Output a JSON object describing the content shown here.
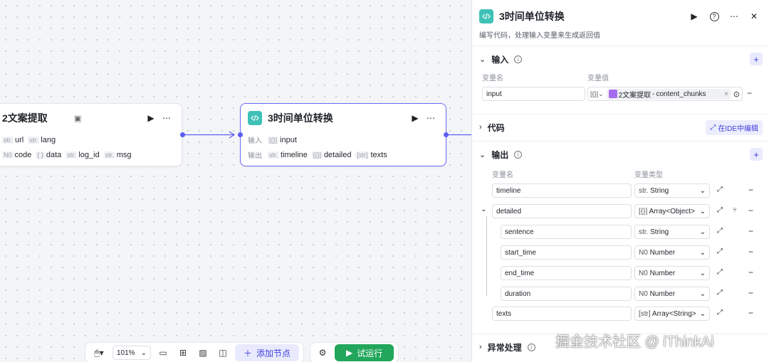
{
  "canvas": {
    "node2": {
      "title": "2文案提取",
      "inputs": [
        {
          "type": "str.",
          "name": "url"
        },
        {
          "type": "str.",
          "name": "lang"
        }
      ],
      "outputs": [
        {
          "type": "N0",
          "name": "code"
        },
        {
          "type": "{ }",
          "name": "data"
        },
        {
          "type": "str.",
          "name": "log_id"
        },
        {
          "type": "str.",
          "name": "msg"
        }
      ]
    },
    "node3": {
      "title": "3时间单位转换",
      "input_label": "输入",
      "output_label": "输出",
      "inputs": [
        {
          "type": "[{}]",
          "name": "input"
        }
      ],
      "outputs": [
        {
          "type": "str.",
          "name": "timeline"
        },
        {
          "type": "[{}]",
          "name": "detailed"
        },
        {
          "type": "[str]",
          "name": "texts"
        }
      ]
    }
  },
  "toolbar": {
    "zoom": "101%",
    "add_node": "添加节点",
    "run": "试运行"
  },
  "panel": {
    "title": "3时间单位转换",
    "subtitle": "编写代码，处理输入变量来生成返回值",
    "input_section": {
      "title": "输入",
      "col_name": "变量名",
      "col_value": "变量值",
      "row": {
        "name": "input",
        "type_icon": "[{}]",
        "ref_node": "2文案提取",
        "ref_var": "content_chunks"
      }
    },
    "code_section": {
      "title": "代码",
      "ide_button": "在IDE中编辑"
    },
    "output_section": {
      "title": "输出",
      "col_name": "变量名",
      "col_type": "变量类型",
      "rows": [
        {
          "name": "timeline",
          "type_icon": "str.",
          "type": "String"
        },
        {
          "name": "detailed",
          "type_icon": "[{}]",
          "type": "Array<Object>"
        },
        {
          "name": "sentence",
          "type_icon": "str.",
          "type": "String"
        },
        {
          "name": "start_time",
          "type_icon": "N0",
          "type": "Number"
        },
        {
          "name": "end_time",
          "type_icon": "N0",
          "type": "Number"
        },
        {
          "name": "duration",
          "type_icon": "N0",
          "type": "Number"
        },
        {
          "name": "texts",
          "type_icon": "[str]",
          "type": "Array<String>"
        }
      ]
    },
    "error_section": {
      "title": "异常处理"
    }
  },
  "watermark": "掘金技术社区 @ iThinkAi",
  "colors": {
    "accent": "#5b5ef0",
    "run_green": "#21a65b",
    "node_icon": "#3ec1b6"
  }
}
